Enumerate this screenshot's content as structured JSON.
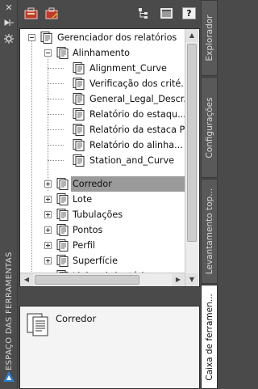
{
  "left_strip": {
    "title": "ESPAÇO DAS FERRAMENTAS",
    "buttons": [
      "close-icon",
      "pin-icon",
      "gear-icon"
    ]
  },
  "toolbar": {
    "icons": [
      "prospector-open-icon",
      "edit-report-icon",
      "tree-view-icon",
      "panel-view-icon",
      "help-icon"
    ],
    "help_label": "?"
  },
  "tree": {
    "root": "Gerenciador dos relatórios",
    "alignment": {
      "label": "Alinhamento",
      "children": [
        "Alignment_Curve",
        "Verificação dos crité...",
        "General_Legal_Descr...",
        "Relatório do estaqu...",
        "Relatório da estaca PI",
        "Relatório do alinha...",
        "Station_and_Curve"
      ]
    },
    "collapsed": [
      "Corredor",
      "Lote",
      "Tubulações",
      "Pontos",
      "Perfil",
      "Superfície",
      "Linha obrigatória"
    ],
    "selected": "Corredor"
  },
  "detail": {
    "label": "Corredor"
  },
  "right_tabs": [
    "Explorador",
    "Configurações",
    "Levantamento top...",
    "Caixa de ferramen..."
  ],
  "active_right_tab": "Caixa de ferramen...",
  "colors": {
    "background": "#4a4a4a",
    "panel": "#ffffff",
    "selection": "#9a9a9a"
  }
}
